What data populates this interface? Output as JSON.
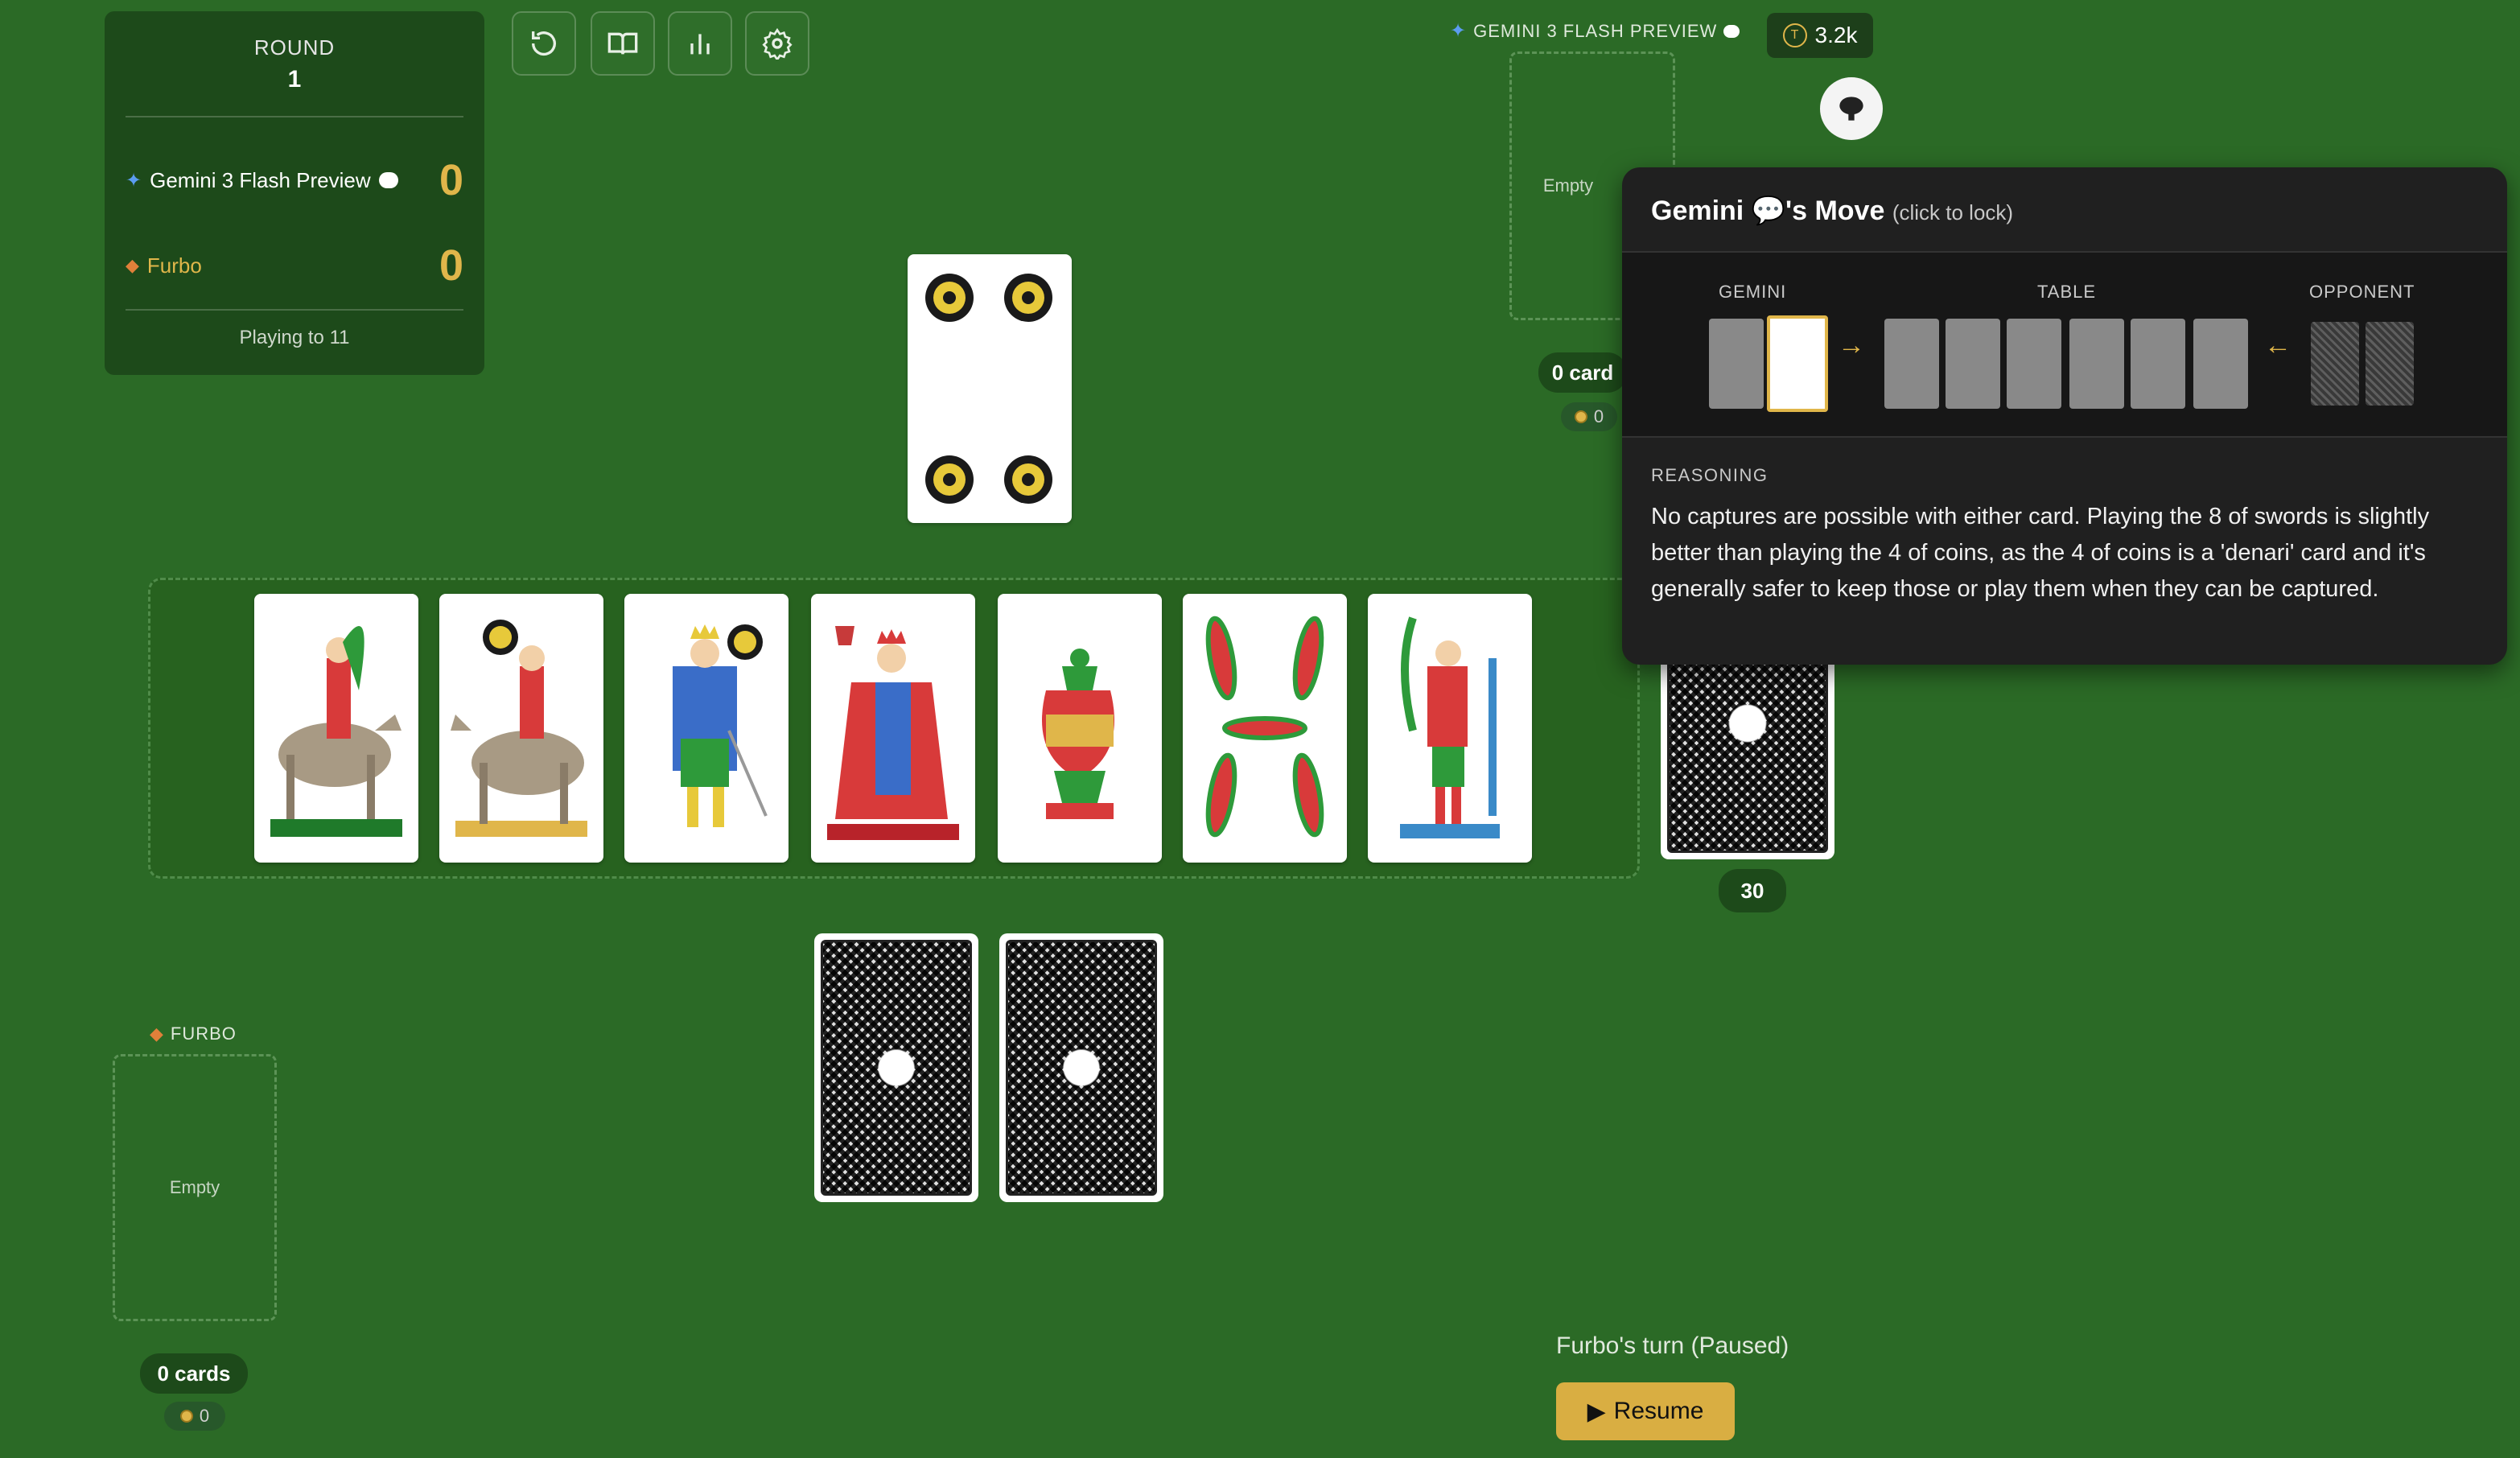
{
  "scoreboard": {
    "round_label": "ROUND",
    "round_number": "1",
    "players": [
      {
        "name": "Gemini 3 Flash Preview",
        "score": "0"
      },
      {
        "name": "Furbo",
        "score": "0"
      }
    ],
    "playing_to": "Playing to 11"
  },
  "toolbar": {
    "icons": [
      "undo-icon",
      "rules-book-icon",
      "stats-icon",
      "settings-icon"
    ]
  },
  "opponent": {
    "label": "GEMINI 3 FLASH PREVIEW",
    "pile_text": "Empty",
    "cards_count": "0 card",
    "coins": "0"
  },
  "player": {
    "label": "FURBO",
    "pile_text": "Empty",
    "cards_count": "0 cards",
    "coins": "0"
  },
  "tokens": {
    "value": "3.2k"
  },
  "deck": {
    "remaining": "30"
  },
  "played_card": {
    "name": "4 of coins",
    "suit": "coins",
    "rank": 4
  },
  "table_cards": [
    {
      "name": "knight of clubs"
    },
    {
      "name": "knight of coins"
    },
    {
      "name": "king of coins"
    },
    {
      "name": "king of cups"
    },
    {
      "name": "ace of cups"
    },
    {
      "name": "4 of clubs"
    },
    {
      "name": "jack of swords"
    }
  ],
  "popup": {
    "title": "Gemini 💬's Move",
    "hint": "(click to lock)",
    "col_gemini": "GEMINI",
    "col_table": "TABLE",
    "col_opponent": "OPPONENT",
    "reasoning_label": "REASONING",
    "reasoning_text": "No captures are possible with either card. Playing the 8 of swords is slightly better than playing the 4 of coins, as the 4 of coins is a 'denari' card and it's generally safer to keep those or play them when they can be captured."
  },
  "status": {
    "turn_text": "Furbo's turn (Paused)",
    "resume_label": "Resume"
  },
  "colors": {
    "felt": "#2b6a26",
    "accent_gold": "#e0b64a",
    "panel": "#1d4a1a"
  }
}
